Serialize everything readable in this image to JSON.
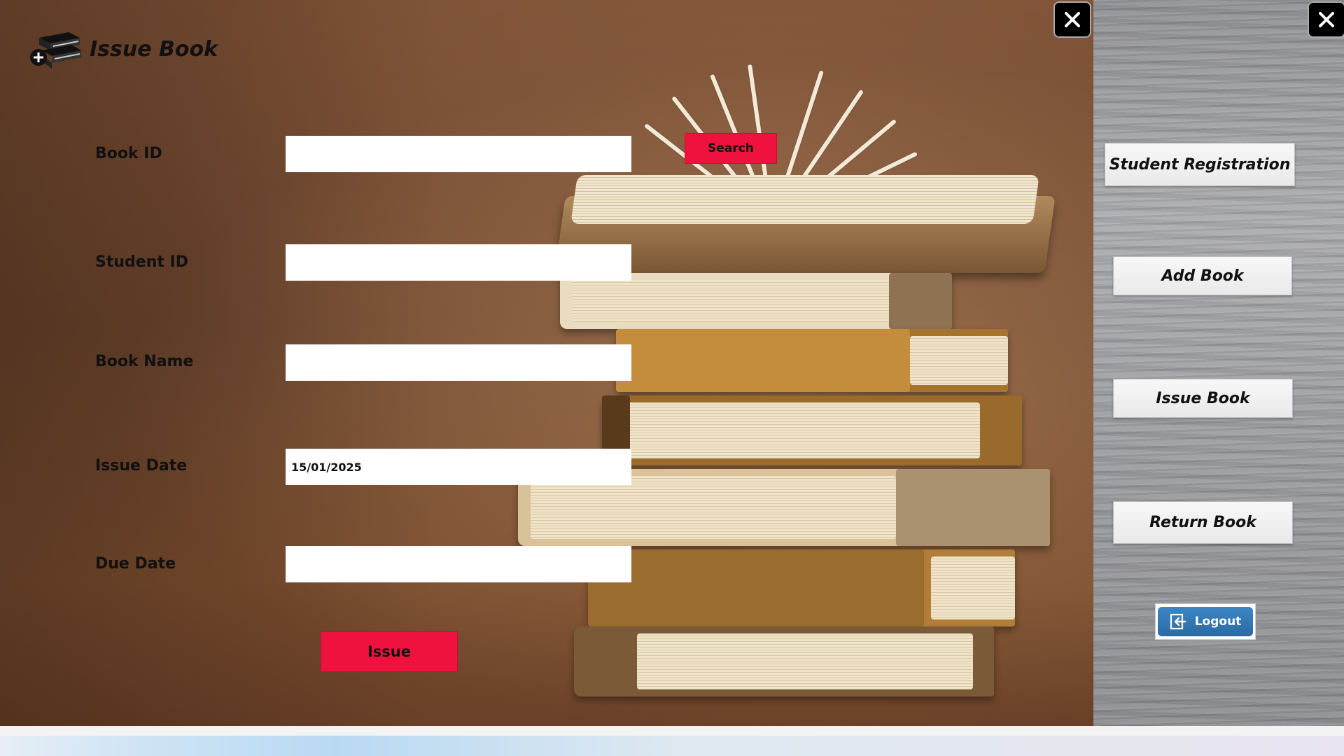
{
  "window": {
    "title": "Issue Book"
  },
  "form": {
    "book_id": {
      "label": "Book ID",
      "value": ""
    },
    "student_id": {
      "label": "Student ID",
      "value": ""
    },
    "book_name": {
      "label": "Book Name",
      "value": ""
    },
    "issue_date": {
      "label": "Issue Date",
      "value": "15/01/2025"
    },
    "due_date": {
      "label": "Due Date",
      "value": ""
    },
    "search_button": "Search",
    "issue_button": "Issue"
  },
  "sidebar": {
    "items": [
      {
        "label": "Student Registration"
      },
      {
        "label": "Add Book"
      },
      {
        "label": "Issue Book"
      },
      {
        "label": "Return Book"
      }
    ],
    "logout_label": "Logout"
  },
  "icons": {
    "title": "books-add-icon",
    "close": "close-icon",
    "logout": "logout-icon"
  },
  "colors": {
    "accent_red": "#f0123e",
    "logout_blue": "#2c6aa3"
  }
}
